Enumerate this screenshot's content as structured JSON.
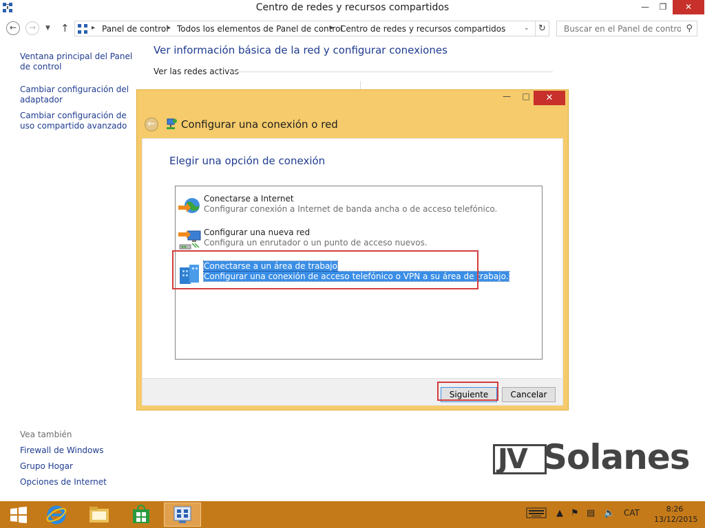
{
  "window": {
    "title": "Centro de redes y recursos compartidos"
  },
  "addressbar": {
    "crumbs": [
      "Panel de control",
      "Todos los elementos de Panel de control",
      "Centro de redes y recursos compartidos"
    ],
    "search_placeholder": "Buscar en el Panel de control"
  },
  "leftnav": {
    "items": [
      "Ventana principal del Panel de control",
      "Cambiar configuración del adaptador",
      "Cambiar configuración de uso compartido avanzado"
    ],
    "see_also_label": "Vea también",
    "see_also": [
      "Firewall de Windows",
      "Grupo Hogar",
      "Opciones de Internet"
    ]
  },
  "main": {
    "title": "Ver información básica de la red y configurar conexiones",
    "active_networks": "Ver las redes activas"
  },
  "dialog": {
    "title": "Configurar una conexión o red",
    "heading": "Elegir una opción de conexión",
    "options": [
      {
        "title": "Conectarse a Internet",
        "desc": "Configurar conexión a Internet de banda ancha o de acceso telefónico.",
        "icon": "globe-network-icon"
      },
      {
        "title": "Configurar una nueva red",
        "desc": "Configura un enrutador o un punto de acceso nuevos.",
        "icon": "new-network-icon"
      },
      {
        "title": "Conectarse a un área de trabajo",
        "desc": "Configurar una conexión de acceso telefónico o VPN a su área de trabajo.",
        "icon": "workplace-vpn-icon",
        "selected": true
      }
    ],
    "next_label": "Siguiente",
    "cancel_label": "Cancelar"
  },
  "watermark": {
    "text_a": "JV",
    "text_b": "Solanes"
  },
  "taskbar": {
    "language": "CAT",
    "time": "8:26",
    "date": "13/12/2015"
  },
  "colors": {
    "accent": "#f5cb6b",
    "taskbar": "#c57a1a",
    "link": "#1e3b8f",
    "highlight": "#d43c3c",
    "selection": "#3a8ee6"
  }
}
